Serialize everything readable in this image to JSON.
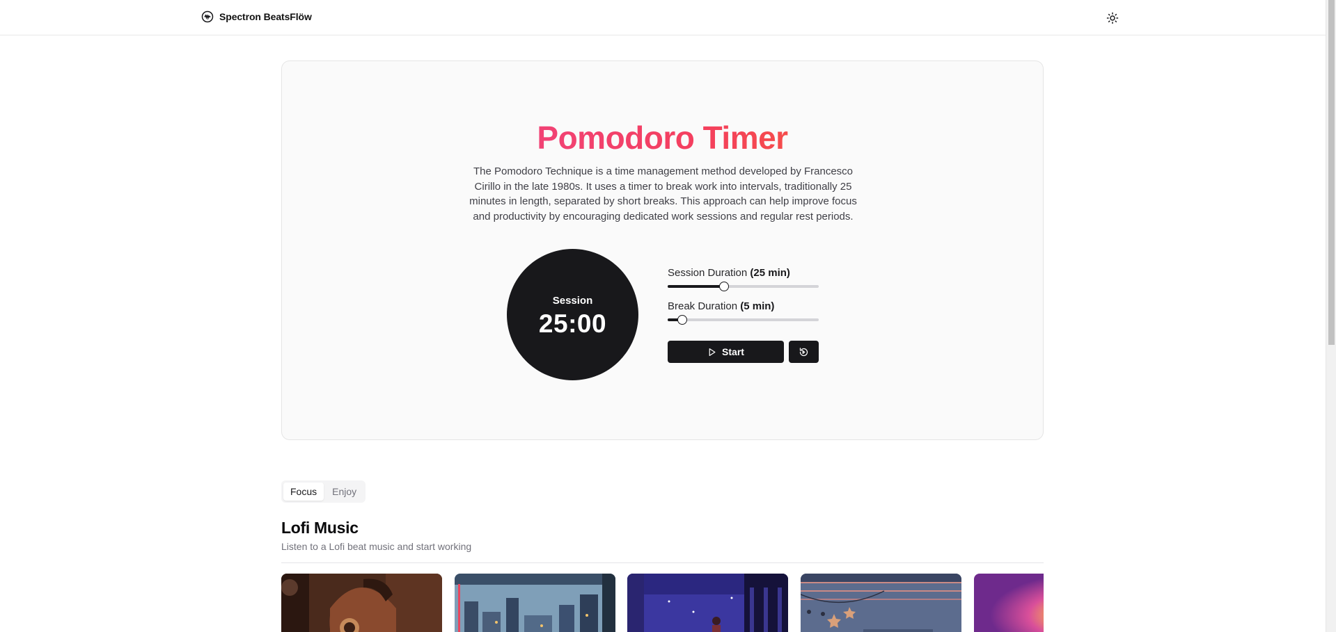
{
  "header": {
    "brand": "Spectron BeatsFlöw",
    "logo_icon": "waveform-logo-icon",
    "theme_icon": "sun-icon"
  },
  "pomodoro": {
    "title": "Pomodoro Timer",
    "description": "The Pomodoro Technique is a time management method developed by Francesco Cirillo in the late 1980s. It uses a timer to break work into intervals, traditionally 25 minutes in length, separated by short breaks. This approach can help improve focus and productivity by encouraging dedicated work sessions and regular rest periods.",
    "timer_label": "Session",
    "timer_value": "25:00",
    "session": {
      "label": "Session Duration",
      "value_text": "(25 min)",
      "fraction": 0.375
    },
    "break": {
      "label": "Break Duration",
      "value_text": "(5 min)",
      "fraction": 0.095
    },
    "start_label": "Start",
    "start_icon": "play-icon",
    "reset_icon": "reset-icon"
  },
  "tabs": [
    {
      "label": "Focus",
      "active": true
    },
    {
      "label": "Enjoy",
      "active": false
    }
  ],
  "section": {
    "title": "Lofi Music",
    "subtitle": "Listen to a Lofi beat music and start working"
  },
  "cards": [
    {
      "name": "lofi-card-headphones-girl",
      "colors": [
        "#3a2318",
        "#6b3b26",
        "#c9884f"
      ]
    },
    {
      "name": "lofi-card-rainy-city",
      "colors": [
        "#4a6a8a",
        "#8fb0c8",
        "#2a3a55"
      ]
    },
    {
      "name": "lofi-card-night-window",
      "colors": [
        "#2a2670",
        "#4b46b0",
        "#1a1540"
      ]
    },
    {
      "name": "lofi-card-star-lights",
      "colors": [
        "#3c4a6e",
        "#6f7fa0",
        "#c99a8a"
      ]
    },
    {
      "name": "lofi-card-sunset-sun",
      "colors": [
        "#7b2c8f",
        "#d14fa0",
        "#ffd23a"
      ]
    }
  ]
}
